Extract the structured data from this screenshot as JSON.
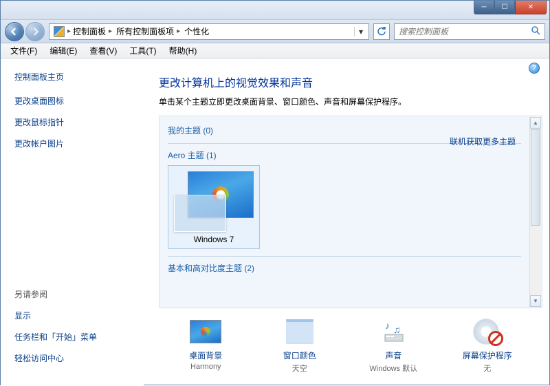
{
  "titlebar": {
    "min": "─",
    "max": "☐",
    "close": "✕"
  },
  "addr": {
    "breadcrumb": [
      "控制面板",
      "所有控制面板项",
      "个性化"
    ],
    "search_placeholder": "搜索控制面板"
  },
  "menu": [
    "文件(F)",
    "编辑(E)",
    "查看(V)",
    "工具(T)",
    "帮助(H)"
  ],
  "sidebar": {
    "home": "控制面板主页",
    "links": [
      "更改桌面图标",
      "更改鼠标指针",
      "更改帐户图片"
    ],
    "see_also_heading": "另请参阅",
    "see_also": [
      "显示",
      "任务栏和「开始」菜单",
      "轻松访问中心"
    ]
  },
  "main": {
    "heading": "更改计算机上的视觉效果和声音",
    "sub": "单击某个主题立即更改桌面背景、窗口颜色、声音和屏幕保护程序。",
    "sections": {
      "my": {
        "label": "我的主题 (0)"
      },
      "aero": {
        "label": "Aero 主题 (1)",
        "items": [
          "Windows 7"
        ]
      },
      "basic": {
        "label": "基本和高对比度主题 (2)"
      }
    },
    "online_link": "联机获取更多主题"
  },
  "bottom": [
    {
      "label": "桌面背景",
      "value": "Harmony"
    },
    {
      "label": "窗口颜色",
      "value": "天空"
    },
    {
      "label": "声音",
      "value": "Windows 默认"
    },
    {
      "label": "屏幕保护程序",
      "value": "无"
    }
  ]
}
